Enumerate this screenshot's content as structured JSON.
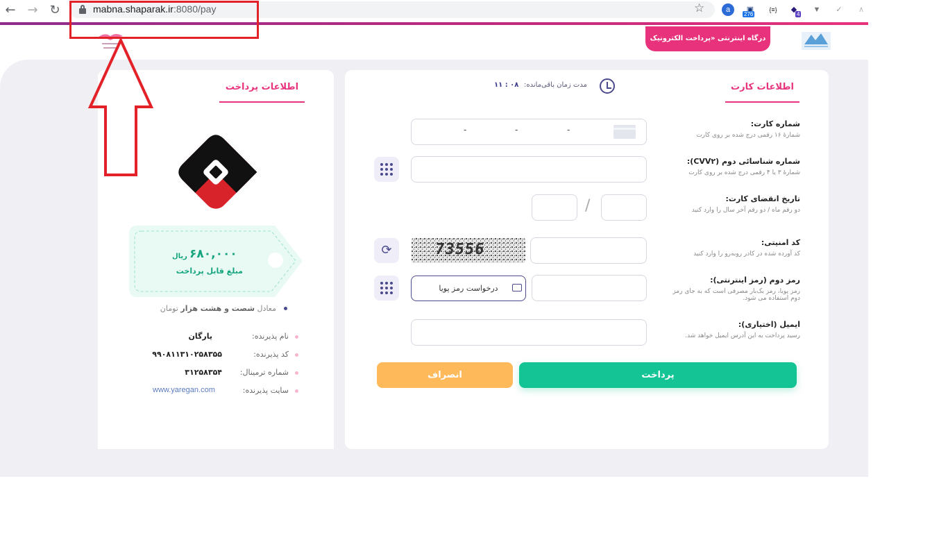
{
  "browser": {
    "url_host": "mabna.shaparak.ir",
    "url_path": ":8080/pay",
    "ext_badge_count": "276",
    "ext_badge_count_2": "4",
    "ext_label_json": "{≡}"
  },
  "header": {
    "gateway_title": "درگاه اینترنتی «پرداخت الکترونیک سپهر»"
  },
  "card_panel": {
    "tab_label": "اطلاعات کارت",
    "timer_label": "مدت زمان باقی‌مانده:",
    "timer_value": "۱۱ : ۰۸",
    "fields": {
      "card_number": {
        "label": "شماره کارت:",
        "hint": "شمارهٔ ۱۶ رقمی درج شده بر روی کارت",
        "dash": "-"
      },
      "cvv2": {
        "label": "شماره شناسائی دوم (CVV۲):",
        "hint": "شمارهٔ ۳ یا ۴ رقمی درج شده بر روی کارت"
      },
      "expiry": {
        "label": "تاریخ انقضای کارت:",
        "hint": "دو رقم ماه / دو رقم آخر سال را وارد کنید",
        "separator": "/"
      },
      "captcha": {
        "label": "کد امنیتی:",
        "hint": "کد آورده شده در کادر روبه‌رو را وارد کنید",
        "image_text": "73556"
      },
      "otp": {
        "label": "رمز دوم (رمز اینترنتی):",
        "hint": "رمز پویا، رمز یک‌بار مصرفی است که به جای رمز دوم استفاده می شود.",
        "request_button": "درخواست رمز پویا"
      },
      "email": {
        "label": "ایمیل (اختیاری):",
        "hint": "رسید پرداخت به این آدرس ایمیل خواهد شد."
      }
    },
    "pay_button": "پرداخت",
    "cancel_button": "انصراف"
  },
  "payment_panel": {
    "tab_label": "اطلاعات پرداخت",
    "amount": "۶۸۰,۰۰۰",
    "amount_unit": "ریال",
    "amount_label": "مبلغ قابل پرداخت",
    "words_prefix": "معادل",
    "words_value": "شصت و هشت هزار",
    "words_unit": "تومان",
    "merchant": [
      {
        "label": "نام پذیرنده:",
        "value": "یارگان"
      },
      {
        "label": "کد پذیرنده:",
        "value": "۹۹۰۸۱۱۳۱۰۲۵۸۳۵۵"
      },
      {
        "label": "شماره ترمینال:",
        "value": "۳۱۲۵۸۳۵۴"
      },
      {
        "label": "سایت پذیرنده:",
        "value": "www.yaregan.com"
      }
    ]
  },
  "colors": {
    "accent_pink": "#e8337c",
    "accent_green": "#14c495",
    "accent_orange": "#fdb95a",
    "accent_indigo": "#4b4a8c",
    "annotation_red": "#e32128"
  }
}
